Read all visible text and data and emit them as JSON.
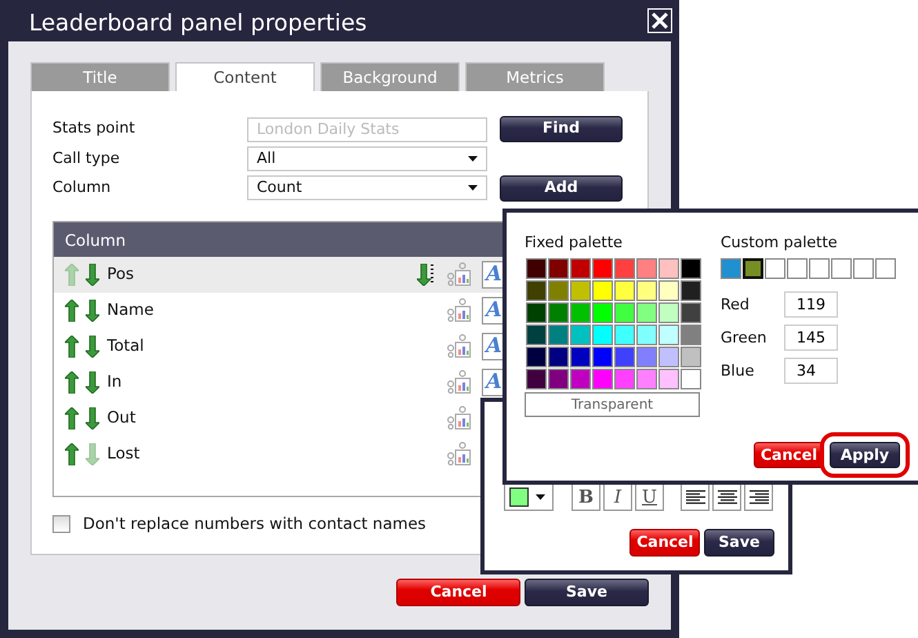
{
  "window": {
    "title": "Leaderboard panel properties"
  },
  "tabs": [
    {
      "label": "Title",
      "selected": false
    },
    {
      "label": "Content",
      "selected": true
    },
    {
      "label": "Background",
      "selected": false
    },
    {
      "label": "Metrics",
      "selected": false
    }
  ],
  "form": {
    "stats_point": {
      "label": "Stats point",
      "placeholder": "London Daily Stats",
      "button": "Find"
    },
    "call_type": {
      "label": "Call type",
      "value": "All"
    },
    "column": {
      "label": "Column",
      "value": "Count",
      "button": "Add"
    }
  },
  "column_list": {
    "header": "Column",
    "rows": [
      {
        "name": "Pos",
        "selected": true,
        "up_enabled": false,
        "down_enabled": true,
        "sorted": true,
        "font_button": "A"
      },
      {
        "name": "Name",
        "selected": false,
        "up_enabled": true,
        "down_enabled": true,
        "sorted": false,
        "font_button": "A"
      },
      {
        "name": "Total",
        "selected": false,
        "up_enabled": true,
        "down_enabled": true,
        "sorted": false,
        "font_button": "A"
      },
      {
        "name": "In",
        "selected": false,
        "up_enabled": true,
        "down_enabled": true,
        "sorted": false,
        "font_button": "A"
      },
      {
        "name": "Out",
        "selected": false,
        "up_enabled": true,
        "down_enabled": true,
        "sorted": false
      },
      {
        "name": "Lost",
        "selected": false,
        "up_enabled": true,
        "down_enabled": false,
        "sorted": false
      }
    ]
  },
  "contact_names": {
    "label": "Don't replace numbers with contact names",
    "checked": false
  },
  "buttons": [
    {
      "label": "Cancel",
      "kind": "cancel"
    },
    {
      "label": "Save",
      "kind": "primary"
    }
  ],
  "format_popup": {
    "swatch": {
      "color": "#80ff80"
    },
    "styles": [
      "B",
      "I",
      "U"
    ],
    "alignments": [
      {
        "kind": "left"
      },
      {
        "kind": "center"
      },
      {
        "kind": "right"
      }
    ],
    "buttons": [
      {
        "label": "Cancel",
        "kind": "cancel"
      },
      {
        "label": "Save",
        "kind": "primary"
      }
    ]
  },
  "color_picker": {
    "fixed_label": "Fixed palette",
    "fixed": [
      {
        "color": "#400000"
      },
      {
        "color": "#800000"
      },
      {
        "color": "#c00000"
      },
      {
        "color": "#ff0000"
      },
      {
        "color": "#ff4040"
      },
      {
        "color": "#ff8080"
      },
      {
        "color": "#ffc0c0"
      },
      {
        "color": "#000000"
      },
      {
        "color": "#404000"
      },
      {
        "color": "#808000"
      },
      {
        "color": "#c0c000"
      },
      {
        "color": "#ffff00"
      },
      {
        "color": "#ffff40"
      },
      {
        "color": "#ffff80"
      },
      {
        "color": "#ffffc0"
      },
      {
        "color": "#202020"
      },
      {
        "color": "#004000"
      },
      {
        "color": "#008000"
      },
      {
        "color": "#00c000"
      },
      {
        "color": "#00ff00"
      },
      {
        "color": "#40ff40"
      },
      {
        "color": "#80ff80"
      },
      {
        "color": "#c0ffc0"
      },
      {
        "color": "#404040"
      },
      {
        "color": "#004040"
      },
      {
        "color": "#008080"
      },
      {
        "color": "#00c0c0"
      },
      {
        "color": "#00ffff"
      },
      {
        "color": "#40ffff"
      },
      {
        "color": "#80ffff"
      },
      {
        "color": "#c0ffff"
      },
      {
        "color": "#808080"
      },
      {
        "color": "#000040"
      },
      {
        "color": "#000080"
      },
      {
        "color": "#0000c0"
      },
      {
        "color": "#0000ff"
      },
      {
        "color": "#4040ff"
      },
      {
        "color": "#8080ff"
      },
      {
        "color": "#c0c0ff"
      },
      {
        "color": "#c0c0c0"
      },
      {
        "color": "#400040"
      },
      {
        "color": "#800080"
      },
      {
        "color": "#c000c0"
      },
      {
        "color": "#ff00ff"
      },
      {
        "color": "#ff40ff"
      },
      {
        "color": "#ff80ff"
      },
      {
        "color": "#ffc0ff"
      },
      {
        "color": "#ffffff"
      }
    ],
    "transparent": "Transparent",
    "custom_label": "Custom palette",
    "custom": [
      {
        "color": "#2090d0",
        "selected": false
      },
      {
        "color": "#778f22",
        "selected": true
      },
      {
        "empty": true
      },
      {
        "empty": true
      },
      {
        "empty": true
      },
      {
        "empty": true
      },
      {
        "empty": true
      },
      {
        "empty": true
      }
    ],
    "channels": [
      {
        "label": "Red",
        "value": "119"
      },
      {
        "label": "Green",
        "value": "145"
      },
      {
        "label": "Blue",
        "value": "34"
      }
    ],
    "buttons": [
      {
        "label": "Cancel",
        "kind": "cancel",
        "highlighted": false
      },
      {
        "label": "Apply",
        "kind": "primary",
        "highlighted": true
      }
    ]
  }
}
